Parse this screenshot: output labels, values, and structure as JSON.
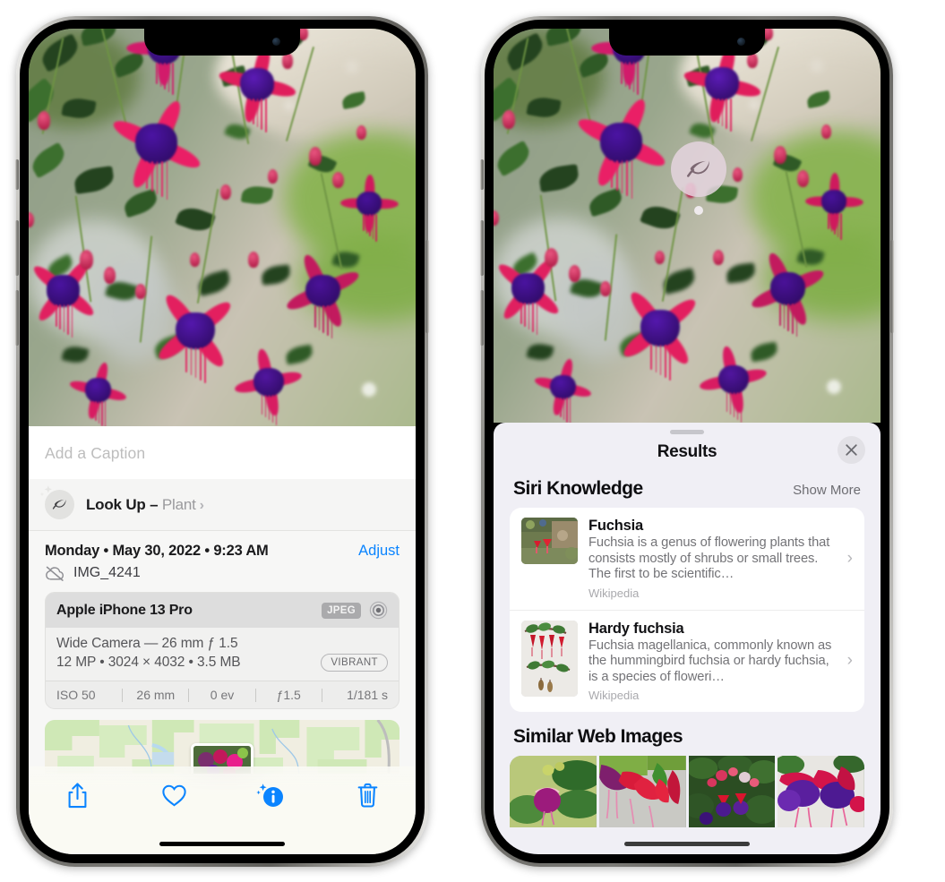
{
  "left_phone": {
    "photo": {
      "alt": "fuchsia-flowers-photo"
    },
    "caption_placeholder": "Add a Caption",
    "caption_value": "",
    "lookup": {
      "label": "Look Up",
      "dash": " – ",
      "subject": "Plant",
      "icon": "leaf-icon",
      "sparkle_icon": "sparkles-icon",
      "chevron": "›"
    },
    "date_line": "Monday • May 30, 2022 • 9:23 AM",
    "adjust_label": "Adjust",
    "filename": "IMG_4241",
    "cloud_icon": "icloud-slash-icon",
    "camera": {
      "device": "Apple iPhone 13 Pro",
      "format_badge": "JPEG",
      "aperture_icon": "raw-circles-icon",
      "lens_line": "Wide Camera — 26 mm ƒ 1.5",
      "specs_line": "12 MP • 3024 × 4032 • 3.5 MB",
      "style_badge": "VIBRANT",
      "exif": [
        "ISO 50",
        "26 mm",
        "0 ev",
        "ƒ1.5",
        "1/181 s"
      ]
    },
    "toolbar": [
      {
        "name": "share-button",
        "icon": "share-icon"
      },
      {
        "name": "favorite-button",
        "icon": "heart-icon"
      },
      {
        "name": "info-button",
        "icon": "info-sparkle-icon"
      },
      {
        "name": "delete-button",
        "icon": "trash-icon"
      }
    ]
  },
  "right_phone": {
    "visual_lookup_badge": {
      "icon": "leaf-icon",
      "name": "visual-lookup-badge"
    },
    "sheet": {
      "title": "Results",
      "close_icon": "close-icon",
      "sections": [
        {
          "title": "Siri Knowledge",
          "action": "Show More",
          "items": [
            {
              "title": "Fuchsia",
              "description": "Fuchsia is a genus of flowering plants that consists mostly of shrubs or small trees. The first to be scientific…",
              "source": "Wikipedia",
              "thumb": "fuchsia-red-flowers-thumb"
            },
            {
              "title": "Hardy fuchsia",
              "description": "Fuchsia magellanica, commonly known as the hummingbird fuchsia or hardy fuchsia, is a species of floweri…",
              "source": "Wikipedia",
              "thumb": "hardy-fuchsia-branch-thumb"
            }
          ]
        },
        {
          "title": "Similar Web Images",
          "images": [
            "fuchsia-white-pink-thumb",
            "fuchsia-red-closeup-thumb",
            "fuchsia-bush-thumb",
            "fuchsia-purple-red-thumb"
          ]
        }
      ]
    }
  },
  "colors": {
    "accent_blue": "#0a84ff",
    "sheet_bg": "#f7f7f6",
    "results_bg": "#f0eff5",
    "card_white": "#ffffff",
    "muted_text": "#737377"
  }
}
